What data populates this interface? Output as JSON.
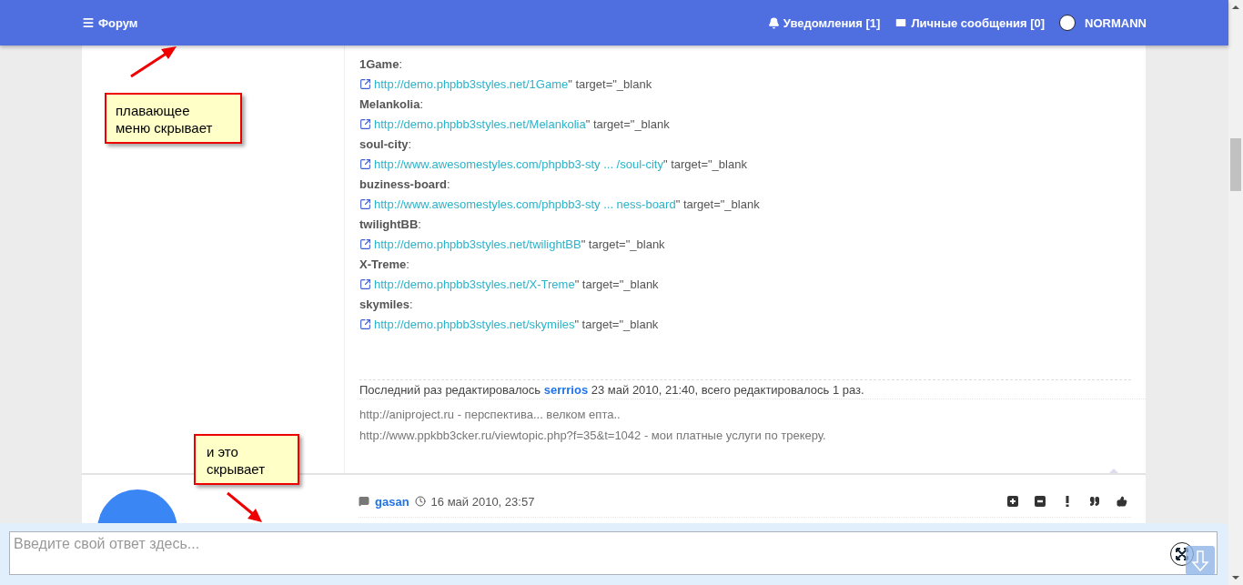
{
  "navbar": {
    "forum": "Форум",
    "notifications": "Уведомления [1]",
    "messages": "Личные сообщения [0]",
    "user": "NORMANN"
  },
  "post": {
    "entries": [
      {
        "label": "**1Game**:",
        "url": "http://demo.phpbb3styles.net/1Game",
        "suffix": "\" target=\"_blank"
      },
      {
        "label": "**Melankolia**:",
        "url": "http://demo.phpbb3styles.net/Melankolia",
        "suffix": "\" target=\"_blank"
      },
      {
        "label": "**soul-city**:",
        "url": "http://www.awesomestyles.com/phpbb3-sty ... /soul-city",
        "suffix": "\" target=\"_blank"
      },
      {
        "label": "**buziness-board**:",
        "url": "http://www.awesomestyles.com/phpbb3-sty ... ness-board",
        "suffix": "\" target=\"_blank"
      },
      {
        "label": "**twilightBB**:",
        "url": "http://demo.phpbb3styles.net/twilightBB",
        "suffix": "\" target=\"_blank"
      },
      {
        "label": "**X-Treme**:",
        "url": "http://demo.phpbb3styles.net/X-Treme",
        "suffix": "\" target=\"_blank"
      },
      {
        "label": "**skymiles**:",
        "url": "http://demo.phpbb3styles.net/skymiles",
        "suffix": "\" target=\"_blank"
      }
    ],
    "edit_note": {
      "prefix": "Последний раз редактировалось ",
      "user": "serrrios",
      "suffix": " 23 май 2010, 21:40, всего редактировалось 1 раз."
    },
    "signature": [
      "http://aniproject.ru - перспектива... велком епта..",
      "http://www.ppkbb3cker.ru/viewtopic.php?f=35&t=1042 - мои платные услуги по трекеру."
    ]
  },
  "next_post": {
    "author": "gasan",
    "time": "16 май 2010, 23:57",
    "actions": [
      {
        "kind": "plus"
      },
      {
        "kind": "minus"
      },
      {
        "kind": "report"
      },
      {
        "kind": "quote"
      },
      {
        "kind": "like"
      }
    ]
  },
  "reply": {
    "placeholder": "Введите свой ответ здесь..."
  },
  "callouts": [
    "плавающее\nменю скрывает",
    "и это\nскрывает"
  ]
}
